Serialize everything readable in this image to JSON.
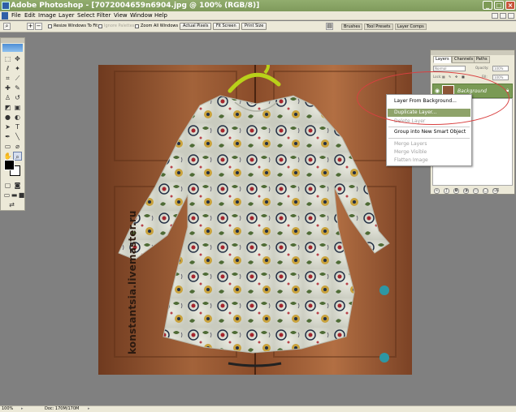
{
  "window": {
    "title": "Adobe Photoshop - [7072004659n6904.jpg @ 100% (RGB/8)]"
  },
  "menubar": {
    "items": [
      "File",
      "Edit",
      "Image",
      "Layer",
      "Select",
      "Filter",
      "View",
      "Window",
      "Help"
    ]
  },
  "options_bar": {
    "resize_windows_label": "Resize Windows To Fit",
    "ignore_palettes_label": "Ignore Palettes",
    "zoom_all_windows_label": "Zoom All Windows",
    "actual_pixels_label": "Actual Pixels",
    "fit_screen_label": "Fit Screen",
    "print_size_label": "Print Size",
    "tabs": [
      "Brushes",
      "Tool Presets",
      "Layer Comps"
    ]
  },
  "toolbox": {
    "tools": [
      "marquee",
      "move",
      "lasso",
      "magic-wand",
      "crop",
      "slice",
      "healing-brush",
      "brush",
      "clone-stamp",
      "history-brush",
      "eraser",
      "gradient",
      "blur",
      "dodge",
      "path-selection",
      "type",
      "pen",
      "shape",
      "notes",
      "eyedropper",
      "hand",
      "zoom"
    ]
  },
  "canvas": {
    "watermark": "konstantsia.livemaster.ru"
  },
  "layers_panel": {
    "tabs": [
      "Layers",
      "Channels",
      "Paths"
    ],
    "blend_mode": "Normal",
    "opacity_label": "Opacity:",
    "opacity_value": "100%",
    "lock_label": "Lock:",
    "fill_label": "Fill:",
    "fill_value": "100%",
    "layer_name": "Background"
  },
  "context_menu": {
    "items": [
      {
        "label": "Layer From Background...",
        "enabled": true
      },
      {
        "label": "Duplicate Layer...",
        "enabled": true,
        "highlighted": true
      },
      {
        "label": "Delete Layer",
        "enabled": false
      },
      {
        "label": "Group into New Smart Object",
        "enabled": true
      },
      {
        "label": "Merge Layers",
        "enabled": false
      },
      {
        "label": "Merge Visible",
        "enabled": false
      },
      {
        "label": "Flatten Image",
        "enabled": false
      }
    ]
  },
  "status_bar": {
    "zoom": "100%",
    "doc_info": "Doc: 170M/170M"
  }
}
